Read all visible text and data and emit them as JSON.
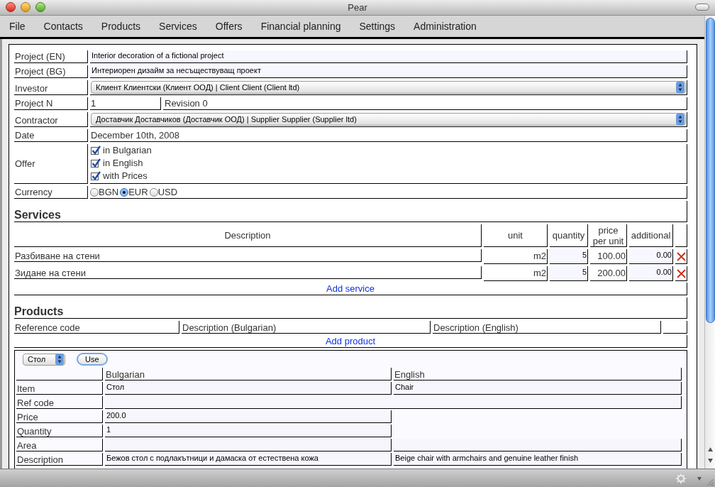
{
  "window": {
    "title": "Pear"
  },
  "menu": [
    "File",
    "Contacts",
    "Products",
    "Services",
    "Offers",
    "Financial planning",
    "Settings",
    "Administration"
  ],
  "fields": [
    {
      "kind": "text",
      "label": "Project (EN)",
      "value": "Interior decoration of a fictional project"
    },
    {
      "kind": "text",
      "label": "Project (BG)",
      "value": "Интериорен дизайм за несъществуващ проект"
    },
    {
      "kind": "select",
      "label": "Investor",
      "value": "Клиент Клиентски (Клиент ООД) | Client Client (Client ltd)"
    },
    {
      "kind": "split",
      "label": "Project N",
      "value": "1",
      "extra": "Revision 0"
    },
    {
      "kind": "select",
      "label": "Contractor",
      "value": "Доставчик Доставчиков (Доставчик ООД) | Supplier Supplier (Supplier ltd)"
    },
    {
      "kind": "static",
      "label": "Date",
      "value": "December 10th, 2008"
    },
    {
      "kind": "checkboxes",
      "label": "Offer",
      "options": [
        {
          "label": "in Bulgarian",
          "checked": true
        },
        {
          "label": "in English",
          "checked": true
        },
        {
          "label": "with Prices",
          "checked": true
        }
      ]
    },
    {
      "kind": "radios",
      "label": "Currency",
      "options": [
        {
          "label": "BGN",
          "selected": false
        },
        {
          "label": "EUR",
          "selected": true
        },
        {
          "label": "USD",
          "selected": false
        }
      ]
    }
  ],
  "services": {
    "title": "Services",
    "columns": [
      "Description",
      "unit",
      "quantity",
      "price per unit",
      "additional"
    ],
    "rows": [
      {
        "description": "Разбиване на стени",
        "unit": "m2",
        "quantity": "5",
        "price": "100.00",
        "additional": "0.00"
      },
      {
        "description": "Зидане на стени",
        "unit": "m2",
        "quantity": "5",
        "price": "200.00",
        "additional": "0.00"
      }
    ],
    "add_link": "Add service"
  },
  "products": {
    "title": "Products",
    "columns": [
      "Reference code",
      "Description (Bulgarian)",
      "Description (English)"
    ],
    "add_link": "Add product",
    "editor": {
      "select": "Стол",
      "button": "Use",
      "columns": [
        "Bulgarian",
        "English"
      ],
      "rows": [
        {
          "kind": "pair",
          "label": "Item",
          "bulgarian": "Стол",
          "english": "Chair"
        },
        {
          "kind": "wide",
          "label": "Ref code"
        },
        {
          "kind": "single",
          "label": "Price",
          "bulgarian": "200.0"
        },
        {
          "kind": "single",
          "label": "Quantity",
          "bulgarian": "1"
        },
        {
          "kind": "pair",
          "label": "Area"
        },
        {
          "kind": "pair",
          "label": "Description",
          "bulgarian": "Бежов стол с подлакътници и дамаска от естествена кожа",
          "english": "Beige chair with armchairs and genuine leather finish"
        }
      ]
    }
  }
}
